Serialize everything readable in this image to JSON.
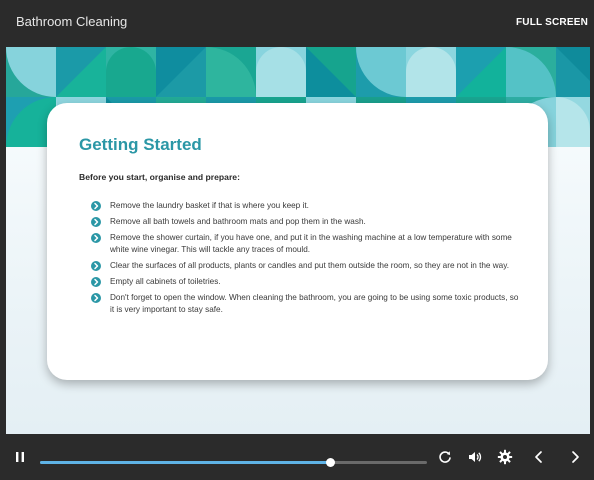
{
  "header": {
    "title": "Bathroom Cleaning",
    "fullscreen_label": "FULL SCREEN"
  },
  "slide": {
    "heading": "Getting Started",
    "intro": "Before you start, organise and prepare:",
    "bullets": [
      "Remove the laundry basket if that is where you keep it.",
      "Remove all bath towels and bathroom mats and pop them in the wash.",
      "Remove the shower curtain, if you have one, and put it in the washing machine at a low temperature with some white wine vinegar. This will tackle any traces of mould.",
      "Clear the surfaces of all products, plants or candles and put them outside the room, so they are not in the way.",
      "Empty all cabinets of toiletries.",
      "Don't forget to open the window. When cleaning the bathroom, you are going to be using some toxic products, so it is very important to stay safe."
    ],
    "accent_color": "#2b97a6"
  },
  "player": {
    "progress": 0.75,
    "progress_color": "#5fb3e6",
    "icons": [
      "pause-icon",
      "replay-icon",
      "volume-icon",
      "settings-icon",
      "previous-icon",
      "next-icon"
    ]
  }
}
